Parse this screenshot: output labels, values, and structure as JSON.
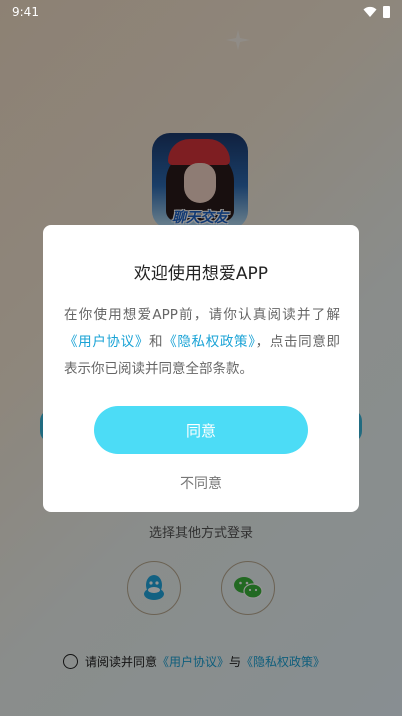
{
  "status_bar": {
    "time": "9:41"
  },
  "logo": {
    "text": "聊天交友"
  },
  "background": {
    "other_login_label": "选择其他方式登录",
    "agreement": {
      "prefix": "请阅读并同意",
      "user_agreement": "《用户协议》",
      "conjunction": "与",
      "privacy_policy": "《隐私权政策》"
    }
  },
  "dialog": {
    "title": "欢迎使用想爱APP",
    "body_prefix": "在你使用想爱APP前，请你认真阅读并了解",
    "user_agreement": "《用户协议》",
    "and": "和",
    "privacy_policy": "《隐私权政策》",
    "body_suffix": "，点击同意即表示你已阅读并同意全部条款。",
    "agree_label": "同意",
    "disagree_label": "不同意"
  },
  "colors": {
    "accent": "#4cdcf6",
    "link": "#1aa3d6"
  },
  "icons": [
    "wifi-icon",
    "battery-icon",
    "qq-icon",
    "wechat-icon",
    "radio-unchecked-icon"
  ]
}
